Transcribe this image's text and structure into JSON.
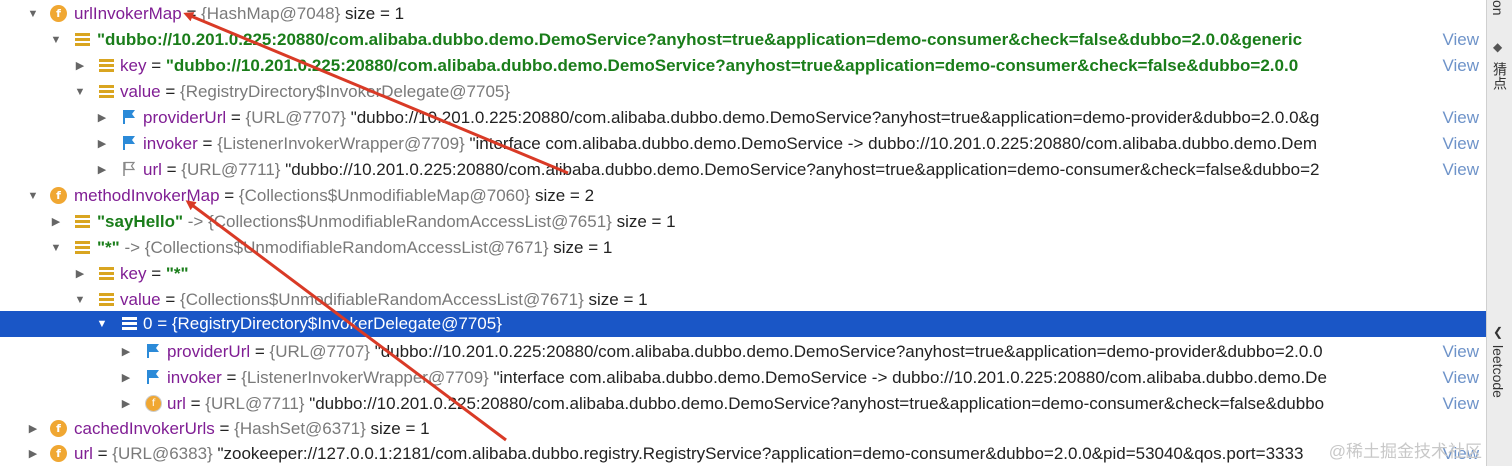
{
  "rows": [
    {
      "name": "urlInvokerMap",
      "eq": " = ",
      "ref": "{HashMap@7048}",
      "rest": "  size = 1",
      "view": ""
    },
    {
      "name": "",
      "eq": "",
      "ref": "",
      "str": "\"dubbo://10.201.0.225:20880/com.alibaba.dubbo.demo.DemoService?anyhost=true&application=demo-consumer&check=false&dubbo=2.0.0&generic",
      "rest": "",
      "view": "View"
    },
    {
      "name": "key",
      "eq": " = ",
      "ref": "",
      "str": "\"dubbo://10.201.0.225:20880/com.alibaba.dubbo.demo.DemoService?anyhost=true&application=demo-consumer&check=false&dubbo=2.0.0",
      "rest": "",
      "view": "View"
    },
    {
      "name": "value",
      "eq": " = ",
      "ref": "{RegistryDirectory$InvokerDelegate@7705}",
      "rest": "",
      "view": ""
    },
    {
      "name": "providerUrl",
      "eq": " = ",
      "ref": "{URL@7707}",
      "rest": " \"dubbo://10.201.0.225:20880/com.alibaba.dubbo.demo.DemoService?anyhost=true&application=demo-provider&dubbo=2.0.0&g",
      "view": "View"
    },
    {
      "name": "invoker",
      "eq": " = ",
      "ref": "{ListenerInvokerWrapper@7709}",
      "rest": " \"interface com.alibaba.dubbo.demo.DemoService -> dubbo://10.201.0.225:20880/com.alibaba.dubbo.demo.Dem",
      "view": "View"
    },
    {
      "name": "url",
      "eq": " = ",
      "ref": "{URL@7711}",
      "rest": " \"dubbo://10.201.0.225:20880/com.alibaba.dubbo.demo.DemoService?anyhost=true&application=demo-consumer&check=false&dubbo=2",
      "view": "View"
    },
    {
      "name": "methodInvokerMap",
      "eq": " = ",
      "ref": "{Collections$UnmodifiableMap@7060}",
      "rest": "  size = 2",
      "view": ""
    },
    {
      "name": "",
      "eq": "",
      "str": "\"sayHello\"",
      "ref": " -> {Collections$UnmodifiableRandomAccessList@7651}",
      "rest": "  size = 1",
      "view": ""
    },
    {
      "name": "",
      "eq": "",
      "str": "\"*\"",
      "ref": " -> {Collections$UnmodifiableRandomAccessList@7671}",
      "rest": "  size = 1",
      "view": ""
    },
    {
      "name": "key",
      "eq": " = ",
      "str": "\"*\"",
      "ref": "",
      "rest": "",
      "view": ""
    },
    {
      "name": "value",
      "eq": " = ",
      "ref": "{Collections$UnmodifiableRandomAccessList@7671}",
      "rest": "  size = 1",
      "view": ""
    },
    {
      "name": "0",
      "eq": " = ",
      "ref": "{RegistryDirectory$InvokerDelegate@7705}",
      "rest": "",
      "view": ""
    },
    {
      "name": "providerUrl",
      "eq": " = ",
      "ref": "{URL@7707}",
      "rest": " \"dubbo://10.201.0.225:20880/com.alibaba.dubbo.demo.DemoService?anyhost=true&application=demo-provider&dubbo=2.0.0",
      "view": "View"
    },
    {
      "name": "invoker",
      "eq": " = ",
      "ref": "{ListenerInvokerWrapper@7709}",
      "rest": " \"interface com.alibaba.dubbo.demo.DemoService -> dubbo://10.201.0.225:20880/com.alibaba.dubbo.demo.De",
      "view": "View"
    },
    {
      "name": "url",
      "eq": " = ",
      "ref": "{URL@7711}",
      "rest": " \"dubbo://10.201.0.225:20880/com.alibaba.dubbo.demo.DemoService?anyhost=true&application=demo-consumer&check=false&dubbo",
      "view": "View"
    },
    {
      "name": "cachedInvokerUrls",
      "eq": " = ",
      "ref": "{HashSet@6371}",
      "rest": "  size = 1",
      "view": ""
    },
    {
      "name": "url",
      "eq": " = ",
      "ref": "{URL@6383}",
      "rest": " \"zookeeper://127.0.0.1:2181/com.alibaba.dubbo.registry.RegistryService?application=demo-consumer&dubbo=2.0.0&pid=53040&qos.port=3333",
      "view": "View"
    }
  ],
  "sidebar": {
    "top_label": "on",
    "mid_label": "猜点",
    "bottom_label": "leetcode"
  },
  "watermark": "@稀土掘金技术社区",
  "accent": "#1a56c6"
}
